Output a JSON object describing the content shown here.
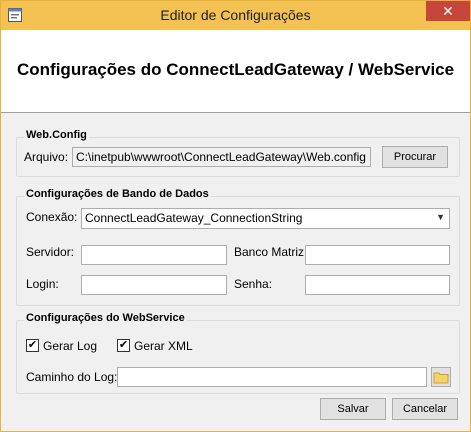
{
  "window": {
    "title": "Editor de Configurações",
    "close_glyph": "✕"
  },
  "header": {
    "heading": "Configurações do ConnectLeadGateway / WebService"
  },
  "webconfig": {
    "legend": "Web.Config",
    "arquivo_label": "Arquivo:",
    "arquivo_value": "C:\\inetpub\\wwwroot\\ConnectLeadGateway\\Web.config",
    "procurar_label": "Procurar"
  },
  "db": {
    "legend": "Configurações de Bando de Dados",
    "conexao_label": "Conexão:",
    "conexao_value": "ConnectLeadGateway_ConnectionString",
    "servidor_label": "Servidor:",
    "banco_label": "Banco Matriz:",
    "login_label": "Login:",
    "senha_label": "Senha:"
  },
  "ws": {
    "legend": "Configurações do WebService",
    "gerar_log_label": "Gerar Log",
    "gerar_xml_label": "Gerar XML",
    "caminho_label": "Caminho do Log:"
  },
  "footer": {
    "salvar_label": "Salvar",
    "cancelar_label": "Cancelar"
  },
  "colors": {
    "title_bar": "#f4c253",
    "close_button": "#c7463c"
  }
}
